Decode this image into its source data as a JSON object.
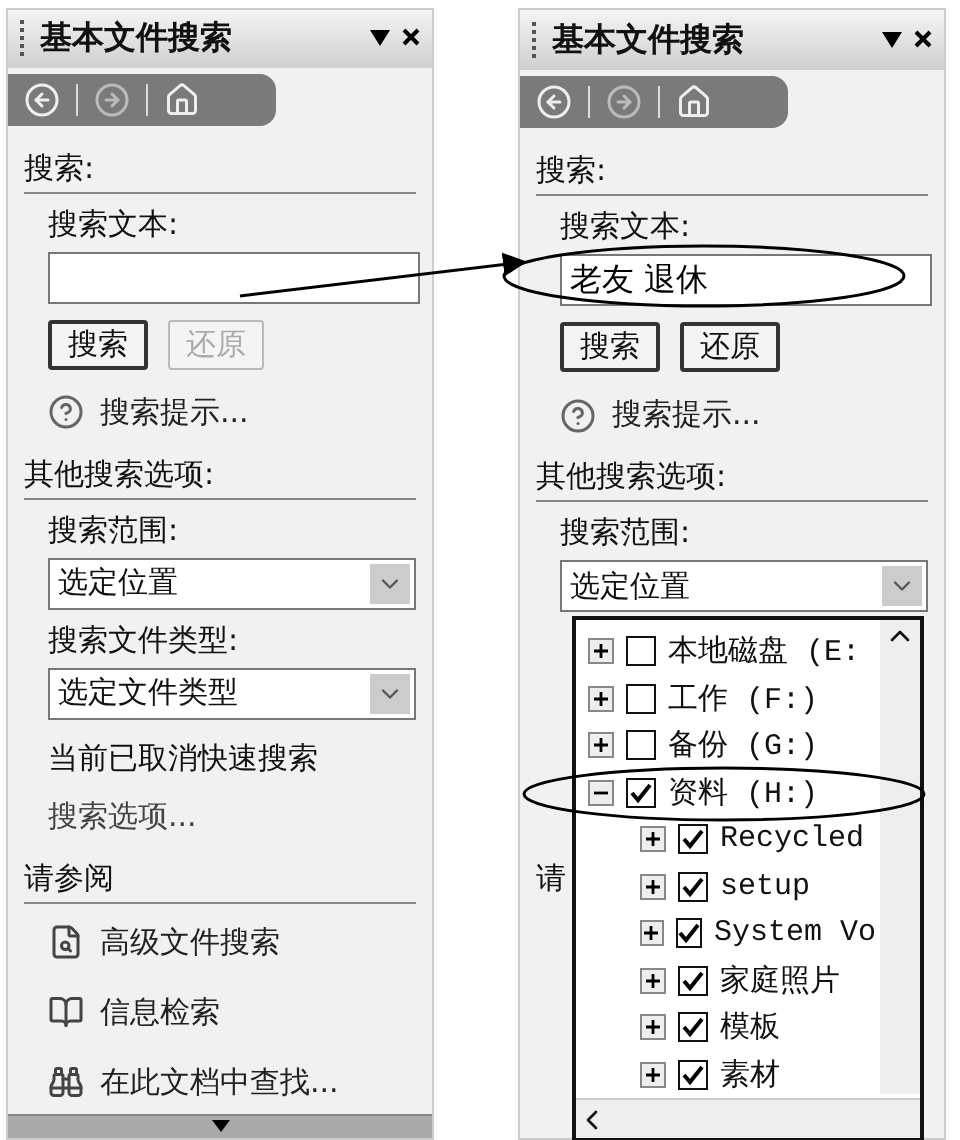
{
  "panes": [
    {
      "title": "基本文件搜索",
      "search_label": "搜索:",
      "text_label": "搜索文本:",
      "buttons": [
        {
          "label": "搜索",
          "disabled": false
        },
        {
          "label": "还原",
          "disabled": true
        }
      ],
      "tips": "搜索提示...",
      "other_label": "其他搜索选项:",
      "scope_label": "搜索范围:",
      "scope_value": "选定位置",
      "type_label": "搜索文件类型:",
      "type_value": "选定文件类型",
      "quick_note": "当前已取消快速搜索",
      "options_link": "搜索选项...",
      "see_also": "请参阅",
      "links": [
        "高级文件搜索",
        "信息检索",
        "在此文档中查找..."
      ]
    },
    {
      "title": "基本文件搜索",
      "search_label": "搜索:",
      "text_label": "搜索文本:",
      "search_text": "老友 退休",
      "buttons": [
        {
          "label": "搜索",
          "disabled": false
        },
        {
          "label": "还原",
          "disabled": false
        }
      ],
      "tips": "搜索提示...",
      "other_label": "其他搜索选项:",
      "scope_label": "搜索范围:",
      "scope_value": "选定位置",
      "see_also": "请",
      "tree": [
        {
          "label": "本地磁盘 (E:",
          "checked": false,
          "expanded": false
        },
        {
          "label": "工作 (F:)",
          "checked": false,
          "expanded": false
        },
        {
          "label": "备份 (G:)",
          "checked": false,
          "expanded": false
        },
        {
          "label": "资料 (H:)",
          "checked": true,
          "expanded": true,
          "children": [
            {
              "label": "Recycled",
              "checked": true,
              "expanded": false
            },
            {
              "label": "setup",
              "checked": true,
              "expanded": false
            },
            {
              "label": "System Vo",
              "checked": true,
              "expanded": false
            },
            {
              "label": "家庭照片",
              "checked": true,
              "expanded": false
            },
            {
              "label": "模板",
              "checked": true,
              "expanded": false
            },
            {
              "label": "素材",
              "checked": true,
              "expanded": false
            }
          ]
        }
      ]
    }
  ]
}
